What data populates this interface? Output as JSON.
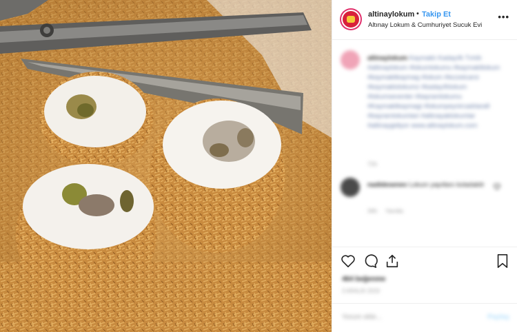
{
  "header": {
    "username": "altinaylokum",
    "separator": "•",
    "follow_label": "Takip Et",
    "subtitle": "Altınay Lokum & Cumhuriyet Sucuk Evi",
    "more_icon": "more-horizontal-icon",
    "more_label": "•••"
  },
  "caption": {
    "author": "altinaylokum",
    "text": "Kaymaklı Kadayıflı Tırtıllı #altinaylokum #lokumlokumu #kaymaklilokum #kaymaklikaymag #lokum #lezzetcarsi #kaymaklolokumz #kadayıflılokum #lokumsevenler #bayramlokumu #Kaymaklikaymagi #lokumpeynircadıtarafi #bayramlokumlari #altinayaklokumlar #altinaygidiyor",
    "link": "www.altinaylokum.com",
    "time": "72h"
  },
  "comment": {
    "author": "nadidesenev",
    "text": "Lokum yapıllanı koladakilr",
    "meta_time": "34h",
    "meta_reply": "Yanıtla"
  },
  "actions": {
    "like_icon": "heart-icon",
    "comment_icon": "comment-icon",
    "share_icon": "share-icon",
    "save_icon": "bookmark-icon",
    "likes_text": "464 beğenme",
    "date_text": "3 ARALIK 2019"
  },
  "add_comment": {
    "placeholder": "Yorum ekle...",
    "post_label": "Paylaş"
  },
  "colors": {
    "accent": "#3897f0",
    "brand": "#e1306c"
  }
}
